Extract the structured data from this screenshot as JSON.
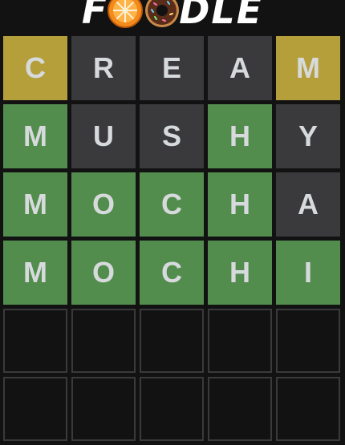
{
  "app": {
    "logo_left": "F",
    "logo_right": "DLE",
    "logo_icons": [
      "orange-slice-icon",
      "donut-icon"
    ]
  },
  "colors": {
    "correct": "#538d4e",
    "present": "#b59f3b",
    "absent": "#3a3a3c",
    "background": "#121213"
  },
  "board": {
    "rows": [
      {
        "tiles": [
          {
            "letter": "C",
            "state": "present"
          },
          {
            "letter": "R",
            "state": "absent"
          },
          {
            "letter": "E",
            "state": "absent"
          },
          {
            "letter": "A",
            "state": "absent"
          },
          {
            "letter": "M",
            "state": "present"
          }
        ]
      },
      {
        "tiles": [
          {
            "letter": "M",
            "state": "correct"
          },
          {
            "letter": "U",
            "state": "absent"
          },
          {
            "letter": "S",
            "state": "absent"
          },
          {
            "letter": "H",
            "state": "correct"
          },
          {
            "letter": "Y",
            "state": "absent"
          }
        ]
      },
      {
        "tiles": [
          {
            "letter": "M",
            "state": "correct"
          },
          {
            "letter": "O",
            "state": "correct"
          },
          {
            "letter": "C",
            "state": "correct"
          },
          {
            "letter": "H",
            "state": "correct"
          },
          {
            "letter": "A",
            "state": "absent"
          }
        ]
      },
      {
        "tiles": [
          {
            "letter": "M",
            "state": "correct"
          },
          {
            "letter": "O",
            "state": "correct"
          },
          {
            "letter": "C",
            "state": "correct"
          },
          {
            "letter": "H",
            "state": "correct"
          },
          {
            "letter": "I",
            "state": "correct"
          }
        ]
      },
      {
        "tiles": [
          {
            "letter": "",
            "state": "empty"
          },
          {
            "letter": "",
            "state": "empty"
          },
          {
            "letter": "",
            "state": "empty"
          },
          {
            "letter": "",
            "state": "empty"
          },
          {
            "letter": "",
            "state": "empty"
          }
        ]
      },
      {
        "tiles": [
          {
            "letter": "",
            "state": "empty"
          },
          {
            "letter": "",
            "state": "empty"
          },
          {
            "letter": "",
            "state": "empty"
          },
          {
            "letter": "",
            "state": "empty"
          },
          {
            "letter": "",
            "state": "empty"
          }
        ]
      }
    ]
  }
}
